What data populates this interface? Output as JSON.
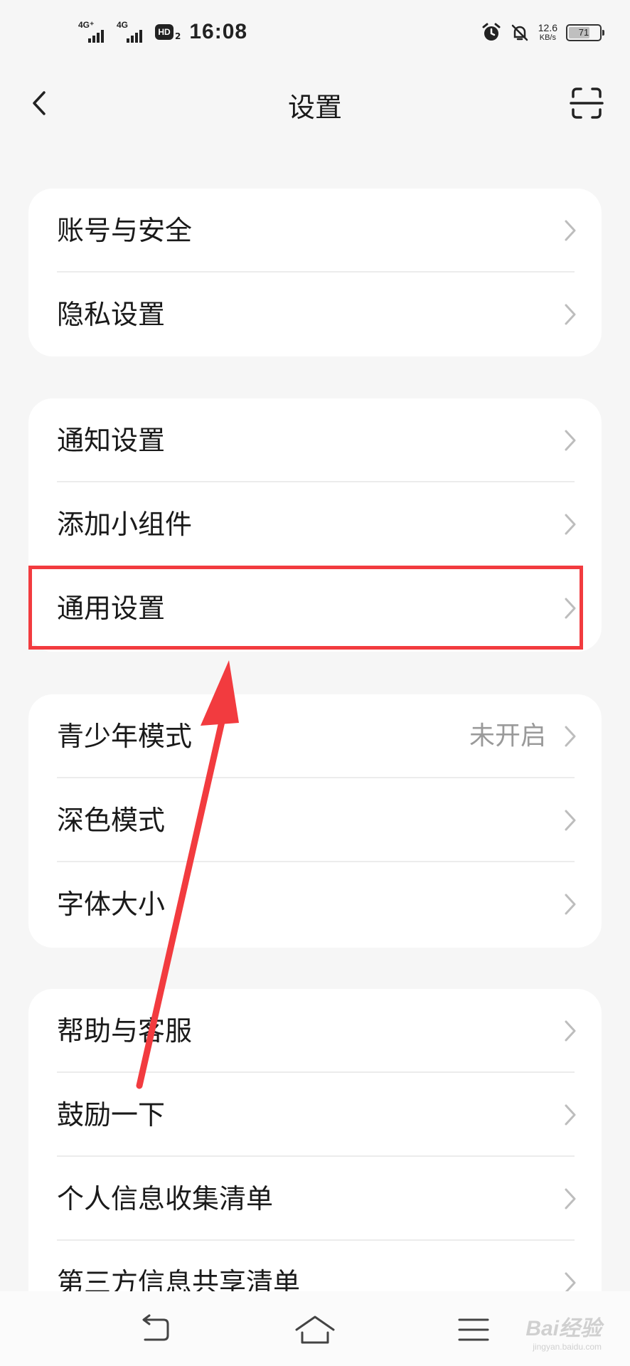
{
  "status_bar": {
    "net1_label": "4G⁺",
    "net2_label": "4G",
    "hd_label": "HD",
    "hd_sub": "2",
    "time": "16:08",
    "speed_value": "12.6",
    "speed_unit": "KB/s",
    "battery_level": "71"
  },
  "header": {
    "title": "设置"
  },
  "groups": [
    {
      "rows": [
        {
          "label": "账号与安全",
          "value": ""
        },
        {
          "label": "隐私设置",
          "value": ""
        }
      ]
    },
    {
      "rows": [
        {
          "label": "通知设置",
          "value": ""
        },
        {
          "label": "添加小组件",
          "value": ""
        },
        {
          "label": "通用设置",
          "value": ""
        }
      ]
    },
    {
      "rows": [
        {
          "label": "青少年模式",
          "value": "未开启"
        },
        {
          "label": "深色模式",
          "value": ""
        },
        {
          "label": "字体大小",
          "value": ""
        }
      ]
    },
    {
      "rows": [
        {
          "label": "帮助与客服",
          "value": ""
        },
        {
          "label": "鼓励一下",
          "value": ""
        },
        {
          "label": "个人信息收集清单",
          "value": ""
        },
        {
          "label": "第三方信息共享清单",
          "value": ""
        }
      ]
    }
  ],
  "watermark": {
    "brand": "Bai经验",
    "url": "jingyan.baidu.com"
  },
  "colors": {
    "background": "#f6f6f6",
    "card": "#ffffff",
    "highlight": "#f23b3f",
    "secondary_text": "#9a9a9a"
  }
}
